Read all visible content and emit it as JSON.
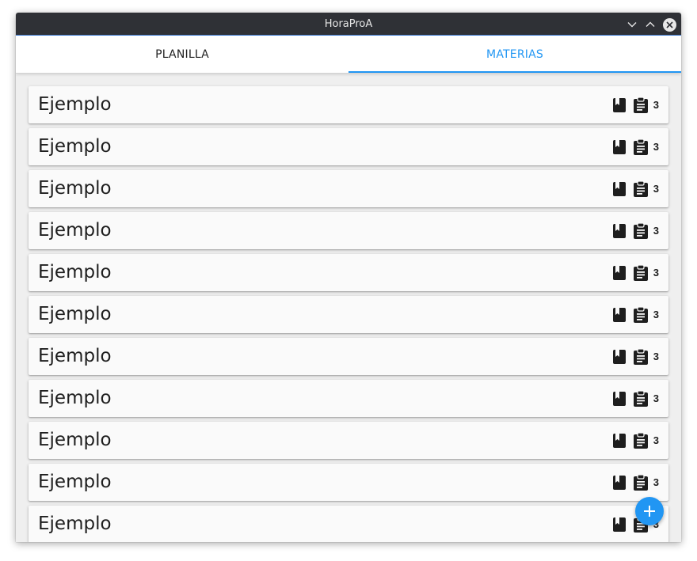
{
  "window": {
    "title": "HoraProA"
  },
  "tabs": [
    {
      "label": "PLANILLA",
      "selected": false
    },
    {
      "label": "MATERIAS",
      "selected": true
    }
  ],
  "colors": {
    "accent": "#2196f3",
    "titlebar": "#2f3136"
  },
  "materias": [
    {
      "name": "Ejemplo",
      "count": "3",
      "icons": [
        "book-icon",
        "clipboard-icon"
      ]
    },
    {
      "name": "Ejemplo",
      "count": "3",
      "icons": [
        "book-icon",
        "clipboard-icon"
      ]
    },
    {
      "name": "Ejemplo",
      "count": "3",
      "icons": [
        "book-icon",
        "clipboard-icon"
      ]
    },
    {
      "name": "Ejemplo",
      "count": "3",
      "icons": [
        "book-icon",
        "clipboard-icon"
      ]
    },
    {
      "name": "Ejemplo",
      "count": "3",
      "icons": [
        "book-icon",
        "clipboard-icon"
      ]
    },
    {
      "name": "Ejemplo",
      "count": "3",
      "icons": [
        "book-icon",
        "clipboard-icon"
      ]
    },
    {
      "name": "Ejemplo",
      "count": "3",
      "icons": [
        "book-icon",
        "clipboard-icon"
      ]
    },
    {
      "name": "Ejemplo",
      "count": "3",
      "icons": [
        "book-icon",
        "clipboard-icon"
      ]
    },
    {
      "name": "Ejemplo",
      "count": "3",
      "icons": [
        "book-icon",
        "clipboard-icon"
      ]
    },
    {
      "name": "Ejemplo",
      "count": "3",
      "icons": [
        "book-icon",
        "clipboard-icon"
      ]
    },
    {
      "name": "Ejemplo",
      "count": "3",
      "icons": [
        "book-icon",
        "clipboard-icon"
      ]
    }
  ],
  "fab": {
    "icon": "plus-icon"
  }
}
